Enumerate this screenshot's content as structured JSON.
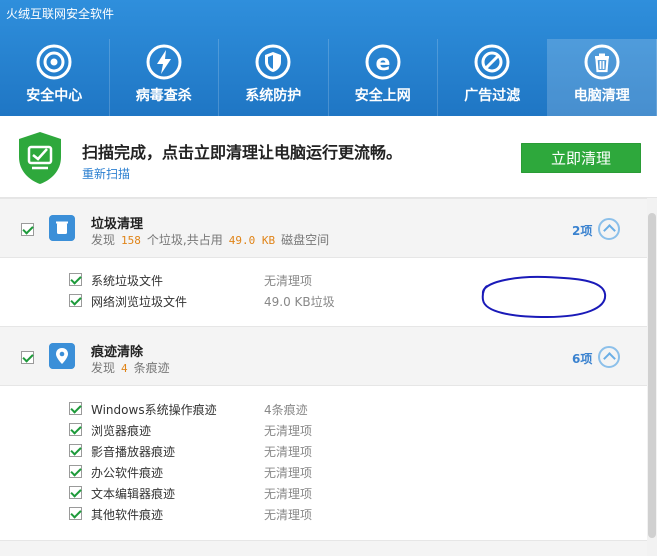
{
  "app": {
    "title": "火绒互联网安全软件"
  },
  "tabs": [
    {
      "label": "安全中心",
      "icon": "target-icon"
    },
    {
      "label": "病毒查杀",
      "icon": "lightning-icon"
    },
    {
      "label": "系统防护",
      "icon": "shield-icon"
    },
    {
      "label": "安全上网",
      "icon": "browser-e-icon"
    },
    {
      "label": "广告过滤",
      "icon": "block-icon"
    },
    {
      "label": "电脑清理",
      "icon": "trash-icon",
      "active": true
    }
  ],
  "banner": {
    "message": "扫描完成，点击立即清理让电脑运行更流畅。",
    "rescan": "重新扫描",
    "clean_button": "立即清理"
  },
  "categories": [
    {
      "title": "垃圾清理",
      "sub_prefix": "发现",
      "sub_count": "158",
      "sub_mid": "个垃圾,共占用",
      "sub_size": "49.0 KB",
      "sub_suffix": "磁盘空间",
      "count_label": "2项",
      "icon": "trash-bin-icon",
      "items": [
        {
          "name": "系统垃圾文件",
          "status": "无清理项"
        },
        {
          "name": "网络浏览垃圾文件",
          "status": "49.0 KB垃圾"
        }
      ]
    },
    {
      "title": "痕迹清除",
      "sub_prefix": "发现",
      "sub_count": "4",
      "sub_suffix": "条痕迹",
      "count_label": "6项",
      "icon": "location-pin-icon",
      "items": [
        {
          "name": "Windows系统操作痕迹",
          "status": "4条痕迹"
        },
        {
          "name": "浏览器痕迹",
          "status": "无清理项"
        },
        {
          "name": "影音播放器痕迹",
          "status": "无清理项"
        },
        {
          "name": "办公软件痕迹",
          "status": "无清理项"
        },
        {
          "name": "文本编辑器痕迹",
          "status": "无清理项"
        },
        {
          "name": "其他软件痕迹",
          "status": "无清理项"
        }
      ]
    }
  ],
  "colors": {
    "header": "#1f76c4",
    "accent_green": "#2ea83c",
    "highlight_orange": "#e08418",
    "link_blue": "#2b7fd0"
  }
}
